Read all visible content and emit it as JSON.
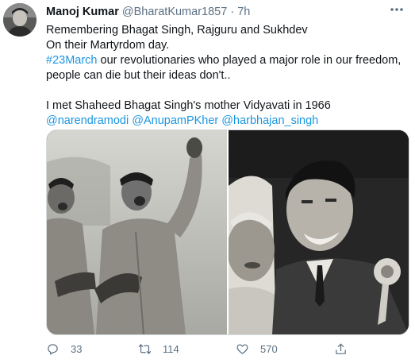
{
  "tweet": {
    "author_name": "Manoj Kumar",
    "handle": "@BharatKumar1857",
    "separator": "·",
    "time": "7h",
    "lines": {
      "l1": "Remembering Bhagat Singh, Rajguru and Sukhdev",
      "l2": "On their Martyrdom day.",
      "l3_hashtag": "#23March",
      "l3_text": " our revolutionaries who played a major role in our freedom,",
      "l4": "people can die but their ideas don't..",
      "l6": "I met Shaheed Bhagat Singh's mother Vidyavati in 1966"
    },
    "mentions": [
      "@narendramodi",
      "@AnupamPKher",
      "@harbhajan_singh"
    ]
  },
  "stats": {
    "replies": "33",
    "retweets": "114",
    "likes": "570"
  },
  "icons": {
    "more": "more-dots-icon",
    "reply": "reply-bubble-icon",
    "retweet": "retweet-arrows-icon",
    "like": "heart-icon",
    "share": "share-upload-icon"
  },
  "colors": {
    "link": "#1b95e0",
    "muted": "#5b7083",
    "text": "#0f1419"
  }
}
